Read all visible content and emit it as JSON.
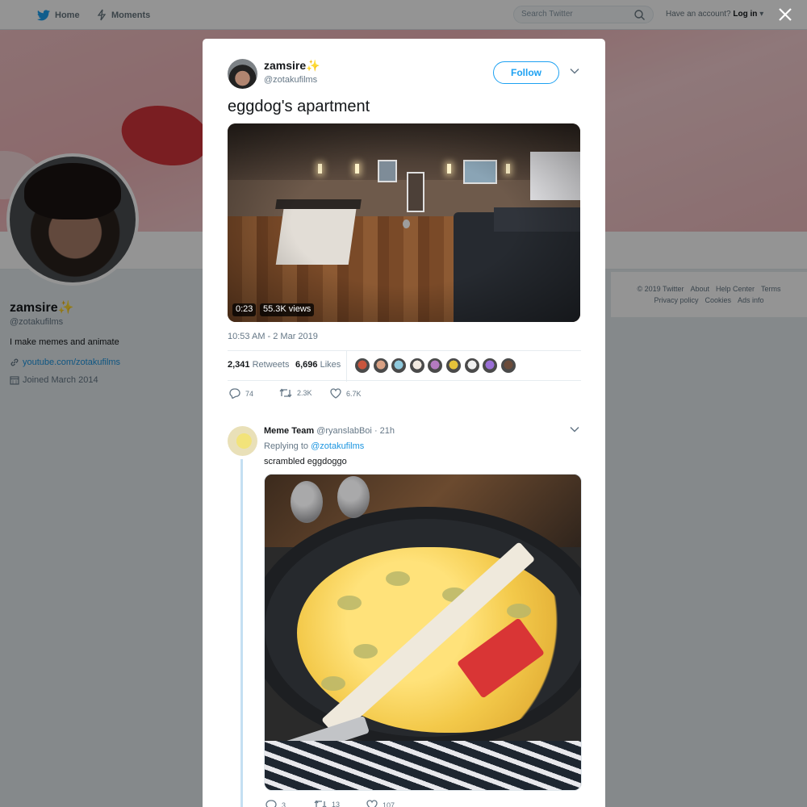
{
  "nav": {
    "home_label": "Home",
    "moments_label": "Moments",
    "search_placeholder": "Search Twitter",
    "have_account": "Have an account?",
    "login_label": "Log in"
  },
  "profile": {
    "name": "zamsire✨",
    "handle": "@zotakufilms",
    "bio": "I make memes and animate",
    "link": "youtube.com/zotakufilms",
    "joined": "Joined March 2014"
  },
  "footer": {
    "links": [
      "© 2019 Twitter",
      "About",
      "Help Center",
      "Terms",
      "Privacy policy",
      "Cookies",
      "Ads info"
    ]
  },
  "tweet": {
    "author_name": "zamsire✨",
    "author_handle": "@zotakufilms",
    "follow_label": "Follow",
    "text": "eggdog's apartment",
    "video_duration": "0:23",
    "video_views": "55.3K views",
    "date": "10:53 AM - 2 Mar 2019",
    "retweets_count": "2,341",
    "retweets_label": "Retweets",
    "likes_count": "6,696",
    "likes_label": "Likes",
    "actions": {
      "replies": "74",
      "retweets": "2.3K",
      "likes": "6.7K"
    },
    "liker_colors": [
      "#c8553d",
      "#d9a184",
      "#8fc9dd",
      "#f1e9e0",
      "#b47ac0",
      "#e4c23a",
      "#efefef",
      "#9a6fd6",
      "#6b4b3a"
    ]
  },
  "reply": {
    "author_name": "Meme Team",
    "author_handle": "@ryanslabBoi",
    "time": "· 21h",
    "replying_to_prefix": "Replying to",
    "replying_to_handle": "@zotakufilms",
    "text": "scrambled eggdoggo",
    "actions": {
      "replies": "3",
      "retweets": "13",
      "likes": "107"
    }
  },
  "colors": {
    "accent": "#1da1f2",
    "link": "#1b95e0",
    "muted": "#657786"
  },
  "icons": [
    "twitter-bird-icon",
    "lightning-icon",
    "search-icon",
    "close-icon",
    "link-icon",
    "calendar-icon",
    "chevron-down-icon",
    "reply-icon",
    "retweet-icon",
    "heart-icon"
  ]
}
